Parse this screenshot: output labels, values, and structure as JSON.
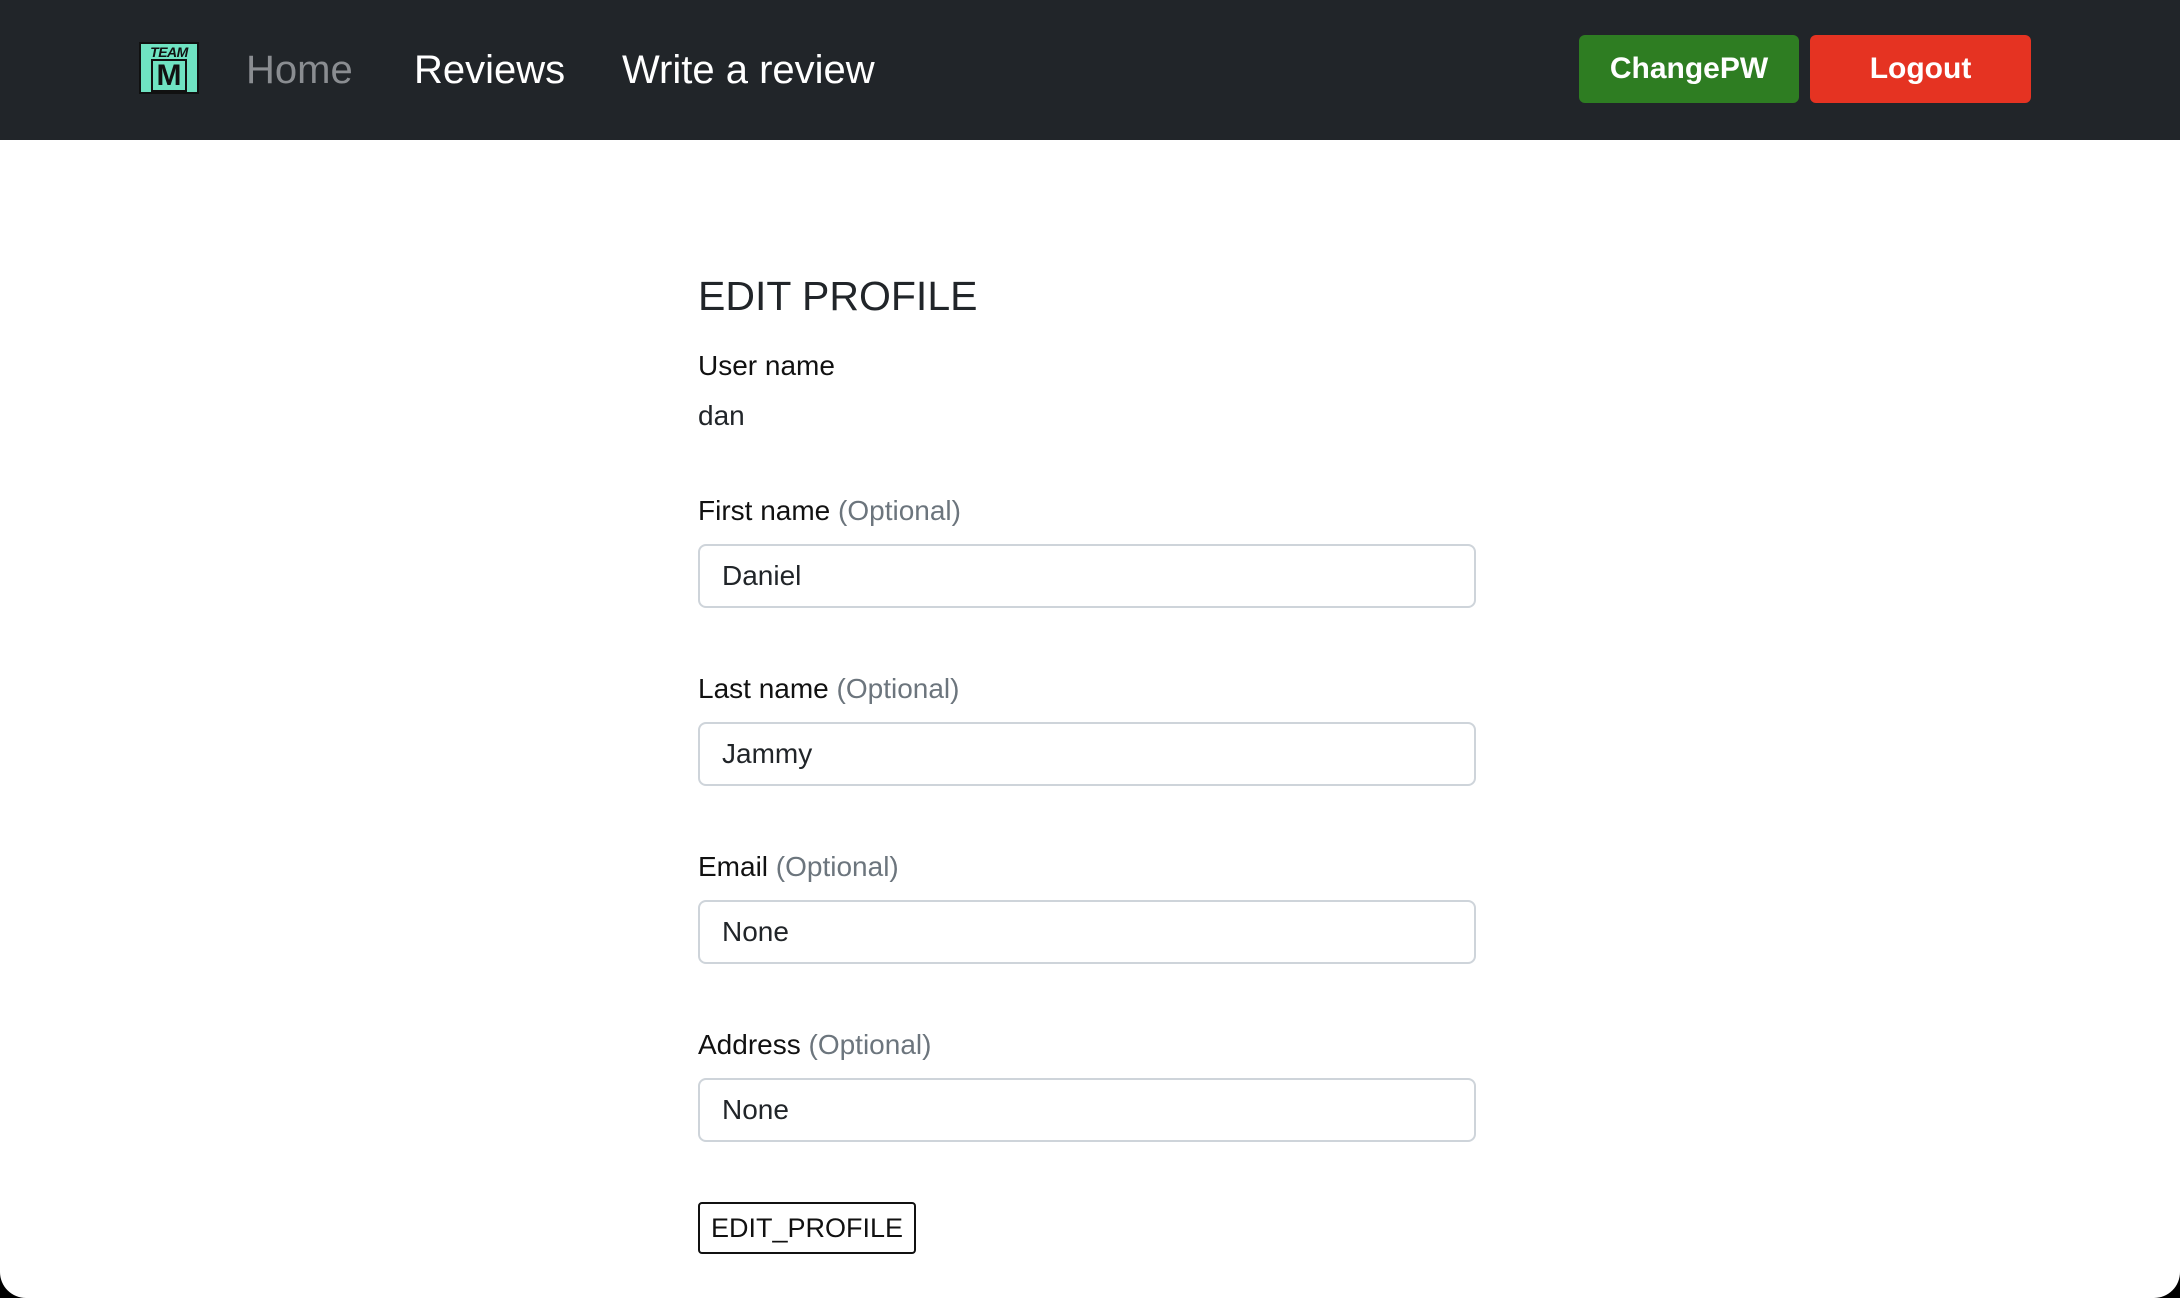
{
  "navbar": {
    "logo": {
      "line1": "TEAM",
      "line2": "M"
    },
    "links": [
      {
        "label": "Home"
      },
      {
        "label": "Reviews"
      },
      {
        "label": "Write a review"
      }
    ],
    "change_pw_label": "ChangePW",
    "logout_label": "Logout"
  },
  "form": {
    "title": "EDIT PROFILE",
    "username_label": "User name",
    "username_value": "dan",
    "optional_text": "(Optional)",
    "fields": [
      {
        "label": "First name",
        "value": "Daniel"
      },
      {
        "label": "Last name",
        "value": "Jammy"
      },
      {
        "label": "Email",
        "value": "None"
      },
      {
        "label": "Address",
        "value": "None"
      }
    ],
    "submit_label": "EDIT_PROFILE"
  },
  "colors": {
    "navbar_bg": "#212529",
    "change_pw_bg": "#2e7d22",
    "logout_bg": "#e53322",
    "logo_bg": "#6fe3c2"
  }
}
